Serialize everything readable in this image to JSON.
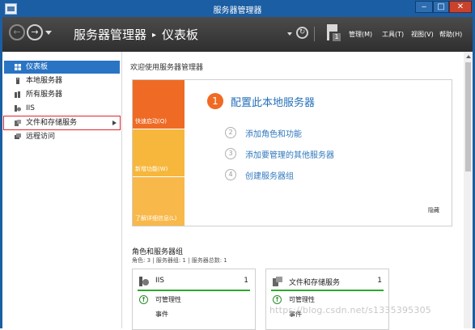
{
  "window": {
    "title": "服务器管理器",
    "min_label": "‒",
    "max_label": "□",
    "close_label": "✕"
  },
  "toolbar": {
    "back_glyph": "←",
    "forward_glyph": "→",
    "breadcrumb": [
      "服务器管理器",
      "仪表板"
    ],
    "breadcrumb_sep": "▸",
    "refresh_glyph": "↻",
    "notification_count": "1",
    "menus": [
      "管理(M)",
      "工具(T)",
      "视图(V)",
      "帮助(H)"
    ]
  },
  "sidebar": {
    "items": [
      {
        "label": "仪表板",
        "icon": "dashboard-icon",
        "active": true
      },
      {
        "label": "本地服务器",
        "icon": "local-server-icon"
      },
      {
        "label": "所有服务器",
        "icon": "all-servers-icon"
      },
      {
        "label": "IIS",
        "icon": "iis-icon"
      },
      {
        "label": "文件和存储服务",
        "icon": "file-storage-icon",
        "highlighted": true,
        "has_submenu": true
      },
      {
        "label": "远程访问",
        "icon": "remote-access-icon"
      }
    ]
  },
  "welcome": {
    "heading": "欢迎使用服务器管理器",
    "tiles": [
      "快速启动(Q)",
      "新增功能(W)",
      "了解详细信息(L)"
    ],
    "step1": {
      "number": "1",
      "label": "配置此本地服务器"
    },
    "steps": [
      {
        "number": "2",
        "label": "添加角色和功能"
      },
      {
        "number": "3",
        "label": "添加要管理的其他服务器"
      },
      {
        "number": "4",
        "label": "创建服务器组"
      }
    ],
    "hide_label": "隐藏"
  },
  "roles": {
    "heading": "角色和服务器组",
    "summary": "角色: 3 | 服务器组: 1 | 服务器总数: 1",
    "cards": [
      {
        "name": "IIS",
        "count": "1",
        "icon": "iis-role-icon",
        "manageability": "可管理性",
        "events": "事件"
      },
      {
        "name": "文件和存储服务",
        "count": "1",
        "icon": "file-storage-role-icon",
        "manageability": "可管理性",
        "events": "事件"
      }
    ]
  },
  "watermark": "https://blog.csdn.net/s1335395305",
  "colors": {
    "titlebar": "#1b5ea3",
    "accent": "#2a74c4",
    "quickstart": "#ef6b25",
    "tile": "#f6b73c",
    "link": "#2570b9",
    "status_ok": "#2fa82f"
  }
}
